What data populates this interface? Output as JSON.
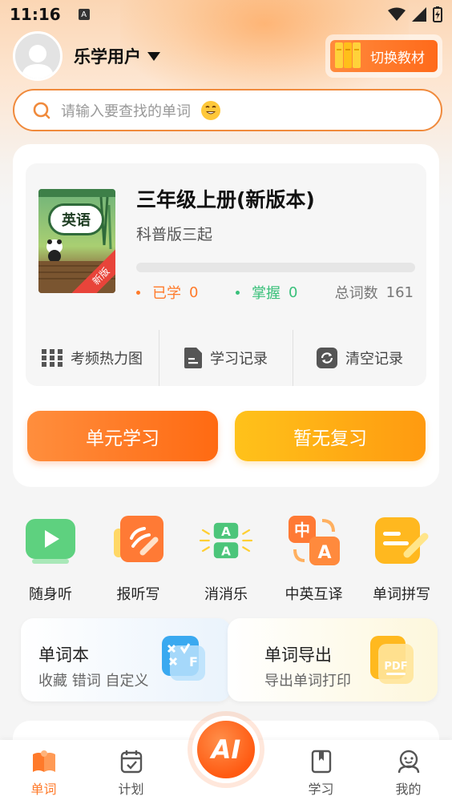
{
  "status_bar": {
    "time": "11:16",
    "notification_letter": "A"
  },
  "header": {
    "user_name": "乐学用户",
    "switch_button_label": "切换教材"
  },
  "search": {
    "placeholder": "请输入要查找的单词"
  },
  "book": {
    "cover_title": "英语",
    "cover_badge": "新版",
    "title": "三年级上册(新版本)",
    "subtitle": "科普版三起",
    "progress_fraction": 0,
    "learned_label": "已学",
    "learned_count": "0",
    "mastered_label": "掌握",
    "mastered_count": "0",
    "total_label": "总词数",
    "total_count": "161"
  },
  "tools": [
    {
      "label": "考频热力图",
      "icon": "grid-icon"
    },
    {
      "label": "学习记录",
      "icon": "document-icon"
    },
    {
      "label": "清空记录",
      "icon": "refresh-icon"
    }
  ],
  "actions": {
    "study_label": "单元学习",
    "review_label": "暂无复习"
  },
  "features": [
    {
      "label": "随身听",
      "icon": "play-icon"
    },
    {
      "label": "报听写",
      "icon": "dictation-icon"
    },
    {
      "label": "消消乐",
      "icon": "match-game-icon"
    },
    {
      "label": "中英互译",
      "icon": "translate-icon"
    },
    {
      "label": "单词拼写",
      "icon": "spelling-icon"
    }
  ],
  "promos": [
    {
      "title": "单词本",
      "subtitle": "收藏 错词 自定义",
      "icon": "wordbook-icon"
    },
    {
      "title": "单词导出",
      "subtitle": "导出单词打印",
      "icon": "pdf-icon"
    }
  ],
  "tab_bar": {
    "tabs": [
      {
        "label": "单词",
        "icon": "book-icon",
        "active": true
      },
      {
        "label": "计划",
        "icon": "calendar-icon",
        "active": false
      },
      {
        "label": "学习",
        "icon": "bookmark-icon",
        "active": false
      },
      {
        "label": "我的",
        "icon": "profile-icon",
        "active": false
      }
    ],
    "center_label": "AI"
  },
  "colors": {
    "accent": "#ff7a2a",
    "mastered": "#39c07a",
    "review": "#ffb015"
  }
}
